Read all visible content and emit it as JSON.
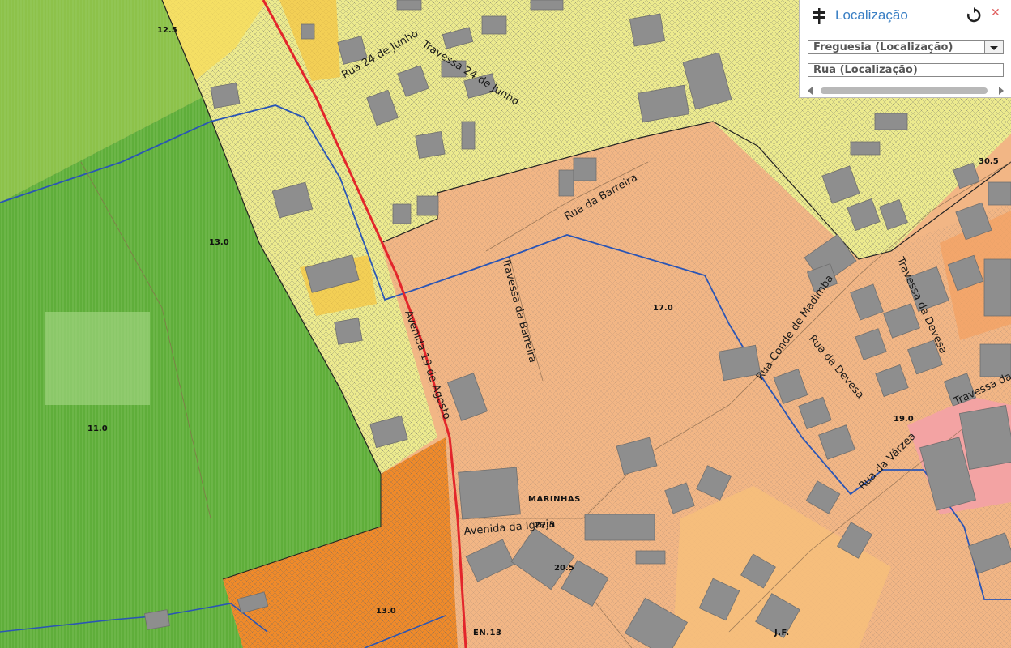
{
  "panel": {
    "title": "Localização",
    "freguesia_placeholder": "Freguesia  (Localização)",
    "rua_placeholder": "Rua (Localização)",
    "close_symbol": "✕"
  },
  "streets": {
    "rua_24_junho": "Rua 24 de Junho",
    "travessa_24_junho": "Travessa 24 de Junho",
    "rua_barreira": "Rua da Barreira",
    "travessa_barreira": "Travessa da Barreira",
    "avenida_19_agosto": "Avenida 19 de Agosto",
    "rua_conde_madimba": "Rua Conde de Madimba",
    "rua_devesa": "Rua da Devesa",
    "travessa_devesa": "Travessa da Devesa",
    "travessa_devesa_2": "Travessa da",
    "rua_varzea": "Rua da Várzea",
    "avenida_igreja": "Avenida da Igreja"
  },
  "places": {
    "marinhas": "MARINHAS",
    "en13": "EN.13",
    "jf": "J.F."
  },
  "elevations": {
    "e1": "12.5",
    "e2": "13.0",
    "e3": "11.0",
    "e4": "17.0",
    "e5": "30.5",
    "e6": "19.0",
    "e7": "27.5",
    "e8": "20.5",
    "e9": "13.0"
  },
  "zone_colors": {
    "agricultural": "#7dbd45",
    "forest_green": "#5fae3a",
    "residential_yellow": "#ecea8e",
    "urban_beige": "#f2b685",
    "central_orange": "#ef8a2a",
    "equipment_pink": "#f3a3a3",
    "road_red": "#e3252b",
    "stream_blue": "#2a55b5"
  },
  "icons": {
    "panel_icon": "signpost-icon",
    "refresh": "refresh-icon",
    "close": "close-icon"
  }
}
